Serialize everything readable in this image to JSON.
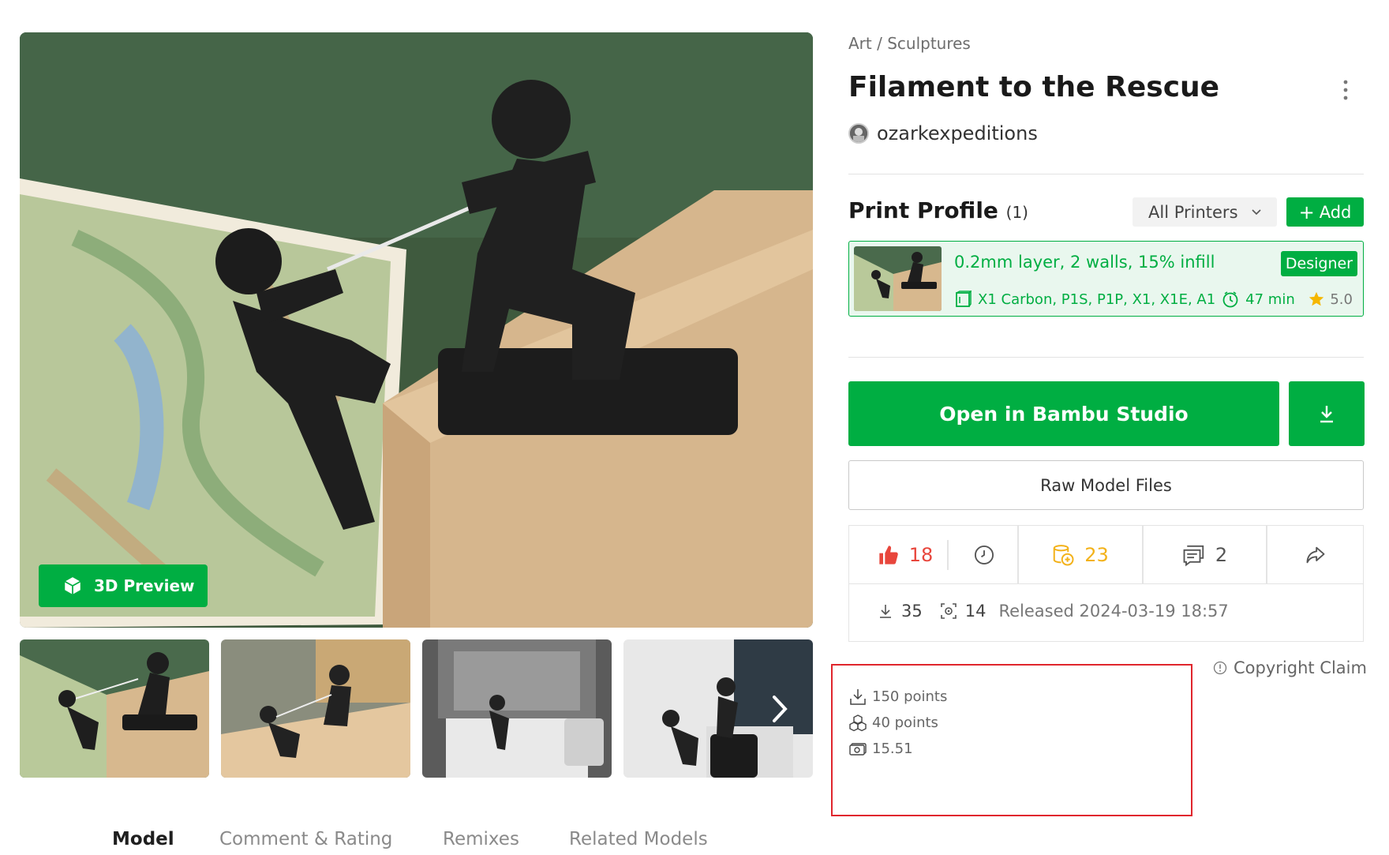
{
  "gallery": {
    "preview_3d_label": "3D Preview",
    "thumbnails": [
      {
        "name": "thumbnail-1"
      },
      {
        "name": "thumbnail-2"
      },
      {
        "name": "thumbnail-3"
      },
      {
        "name": "thumbnail-4"
      }
    ]
  },
  "tabs": [
    "Model",
    "Comment & Rating",
    "Remixes",
    "Related Models"
  ],
  "breadcrumb": "Art / Sculptures",
  "title": "Filament to the Rescue",
  "author": "ozarkexpeditions",
  "print_profile": {
    "heading": "Print Profile",
    "count": "(1)",
    "printer_filter": "All Printers",
    "add_label": "Add",
    "card": {
      "name": "0.2mm layer, 2 walls, 15% infill",
      "badge": "Designer",
      "printers": "X1 Carbon, P1S, P1P, X1, X1E, A1",
      "time": "47 min",
      "rating": "5.0"
    }
  },
  "actions": {
    "open_label": "Open in Bambu Studio",
    "raw_label": "Raw Model Files"
  },
  "stats": {
    "likes": "18",
    "boosts": "23",
    "comments": "2",
    "downloads": "35",
    "prints": "14",
    "released": "Released 2024-03-19 18:57"
  },
  "copyright_label": "Copyright Claim",
  "points": {
    "download_points": "150 points",
    "print_points": "40 points",
    "cash": "15.51"
  },
  "colors": {
    "accent": "#00ae42",
    "like": "#e8463c",
    "boost": "#f3b21a",
    "highlight": "#e0262d"
  }
}
